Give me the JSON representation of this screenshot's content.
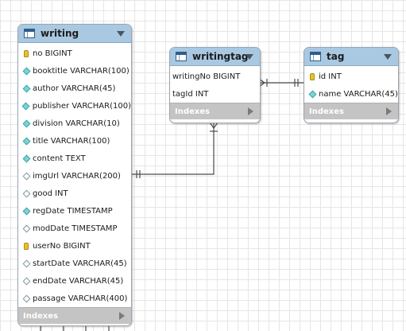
{
  "tables": {
    "writing": {
      "title": "writing",
      "indexes_label": "Indexes",
      "columns": [
        {
          "text": "no BIGINT",
          "icon": "key-icon"
        },
        {
          "text": "booktitle VARCHAR(100)",
          "icon": "column-icon"
        },
        {
          "text": "author VARCHAR(45)",
          "icon": "column-icon"
        },
        {
          "text": "publisher VARCHAR(100)",
          "icon": "column-icon"
        },
        {
          "text": "division VARCHAR(10)",
          "icon": "column-icon"
        },
        {
          "text": "title VARCHAR(100)",
          "icon": "column-icon"
        },
        {
          "text": "content TEXT",
          "icon": "column-icon"
        },
        {
          "text": "imgUrl VARCHAR(200)",
          "icon": "nullable-column-icon"
        },
        {
          "text": "good INT",
          "icon": "nullable-column-icon"
        },
        {
          "text": "regDate TIMESTAMP",
          "icon": "column-icon"
        },
        {
          "text": "modDate TIMESTAMP",
          "icon": "nullable-column-icon"
        },
        {
          "text": "userNo BIGINT",
          "icon": "key-icon"
        },
        {
          "text": "startDate VARCHAR(45)",
          "icon": "nullable-column-icon"
        },
        {
          "text": "endDate VARCHAR(45)",
          "icon": "nullable-column-icon"
        },
        {
          "text": "passage VARCHAR(400)",
          "icon": "nullable-column-icon"
        }
      ]
    },
    "writingtag": {
      "title": "writingtag",
      "indexes_label": "Indexes",
      "columns": [
        {
          "text": "writingNo BIGINT"
        },
        {
          "text": "tagId INT"
        }
      ]
    },
    "tag": {
      "title": "tag",
      "indexes_label": "Indexes",
      "columns": [
        {
          "text": "id INT",
          "icon": "key-icon"
        },
        {
          "text": "name VARCHAR(45)",
          "icon": "column-icon"
        }
      ]
    }
  },
  "relationships": [
    {
      "from": "writing",
      "to": "writingtag",
      "from_end": "one-mandatory",
      "to_end": "many-mandatory"
    },
    {
      "from": "tag",
      "to": "writingtag",
      "from_end": "one-mandatory",
      "to_end": "many-mandatory"
    }
  ],
  "colors": {
    "header": "#a9c8e2",
    "indexes_bar": "#c4c4c4",
    "key": "#e8c12e",
    "column_diamond": "#7fd3d3",
    "connector": "#4a4a4a"
  }
}
